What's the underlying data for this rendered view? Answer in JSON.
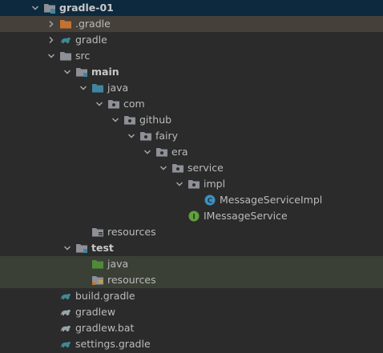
{
  "tree": {
    "items": [
      {
        "label": "gradle-01",
        "arrow": "expanded",
        "icon": "project-module-folder-icon",
        "bold": true,
        "state": "selected"
      },
      {
        "label": ".gradle",
        "arrow": "collapsed",
        "icon": "excluded-folder-icon",
        "bold": false,
        "state": "highlighted"
      },
      {
        "label": "gradle",
        "arrow": "collapsed",
        "icon": "gradle-icon",
        "bold": false,
        "state": "normal"
      },
      {
        "label": "src",
        "arrow": "expanded",
        "icon": "folder-icon",
        "bold": false,
        "state": "normal"
      },
      {
        "label": "main",
        "arrow": "expanded",
        "icon": "module-folder-icon",
        "bold": true,
        "state": "normal"
      },
      {
        "label": "java",
        "arrow": "expanded",
        "icon": "source-root-folder-icon",
        "bold": false,
        "state": "normal"
      },
      {
        "label": "com",
        "arrow": "expanded",
        "icon": "package-icon",
        "bold": false,
        "state": "normal"
      },
      {
        "label": "github",
        "arrow": "expanded",
        "icon": "package-icon",
        "bold": false,
        "state": "normal"
      },
      {
        "label": "fairy",
        "arrow": "expanded",
        "icon": "package-icon",
        "bold": false,
        "state": "normal"
      },
      {
        "label": "era",
        "arrow": "expanded",
        "icon": "package-icon",
        "bold": false,
        "state": "normal"
      },
      {
        "label": "service",
        "arrow": "expanded",
        "icon": "package-icon",
        "bold": false,
        "state": "normal"
      },
      {
        "label": "impl",
        "arrow": "expanded",
        "icon": "package-icon",
        "bold": false,
        "state": "normal"
      },
      {
        "label": "MessageServiceImpl",
        "arrow": "none",
        "icon": "java-class-icon",
        "bold": false,
        "state": "normal"
      },
      {
        "label": "IMessageService",
        "arrow": "none",
        "icon": "java-interface-icon",
        "bold": false,
        "state": "normal"
      },
      {
        "label": "resources",
        "arrow": "none",
        "icon": "resources-folder-icon",
        "bold": false,
        "state": "normal"
      },
      {
        "label": "test",
        "arrow": "expanded",
        "icon": "module-folder-icon",
        "bold": true,
        "state": "normal"
      },
      {
        "label": "java",
        "arrow": "none",
        "icon": "test-source-folder-icon",
        "bold": false,
        "state": "highlighted-green"
      },
      {
        "label": "resources",
        "arrow": "none",
        "icon": "test-resources-folder-icon",
        "bold": false,
        "state": "highlighted-green"
      },
      {
        "label": "build.gradle",
        "arrow": "none",
        "icon": "gradle-icon",
        "bold": false,
        "state": "normal"
      },
      {
        "label": "gradlew",
        "arrow": "none",
        "icon": "gradle-grey-icon",
        "bold": false,
        "state": "normal"
      },
      {
        "label": "gradlew.bat",
        "arrow": "none",
        "icon": "gradle-grey-icon",
        "bold": false,
        "state": "normal"
      },
      {
        "label": "settings.gradle",
        "arrow": "none",
        "icon": "gradle-icon",
        "bold": false,
        "state": "normal"
      }
    ]
  },
  "colors": {
    "background": "#2b2b2b",
    "text": "#bbbbbb",
    "selected_row": "#0d293e",
    "highlight_brown": "#45403a",
    "highlight_green": "#3a4036",
    "folder_grey": "#8d9096",
    "source_blue": "#3e86a0",
    "excluded_orange": "#c4722f",
    "test_green": "#4e8a3a",
    "gradle_teal": "#3c8a95",
    "class_circle": "#3b91c0",
    "interface_circle": "#62a03b"
  }
}
